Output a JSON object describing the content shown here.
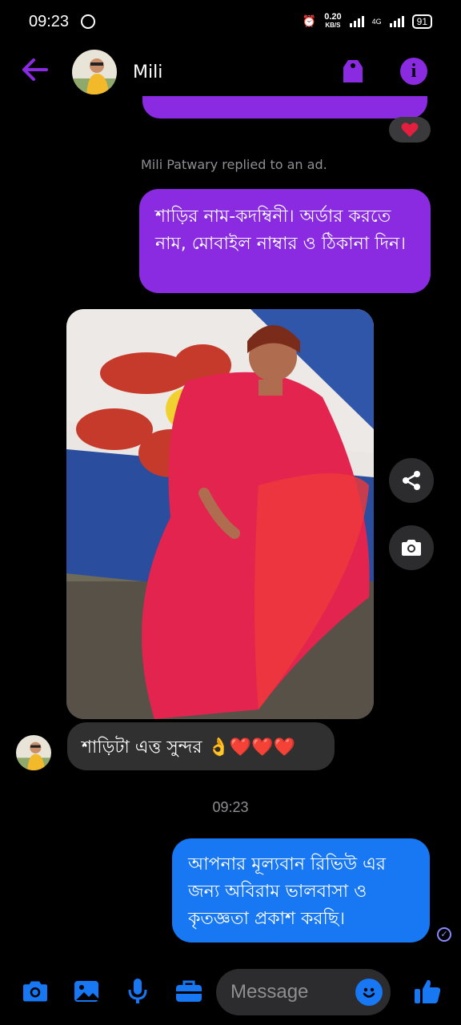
{
  "status_bar": {
    "time": "09:23",
    "net_speed": "0.20",
    "net_unit": "KB/S",
    "network_type": "4G",
    "battery": "91"
  },
  "header": {
    "contact_name": "Mili"
  },
  "chat": {
    "replied_note": "Mili Patwary replied to an ad.",
    "msg_sent_1": "শাড়ির নাম-কদম্বিনী। অর্ডার করতে নাম, মোবাইল নাম্বার ও ঠিকানা দিন।",
    "msg_received_1": "শাড়িটা এত্ত সুন্দর 👌❤️❤️❤️",
    "timestamp": "09:23",
    "msg_sent_2": "আপনার মূল্যবান রিভিউ এর জন্য অবিরাম ভালবাসা ও কৃতজ্ঞতা প্রকাশ করছি।"
  },
  "composer": {
    "placeholder": "Message"
  },
  "colors": {
    "accent": "#8a2be2",
    "sent_blue": "#1877f2",
    "received_gray": "#303030"
  }
}
